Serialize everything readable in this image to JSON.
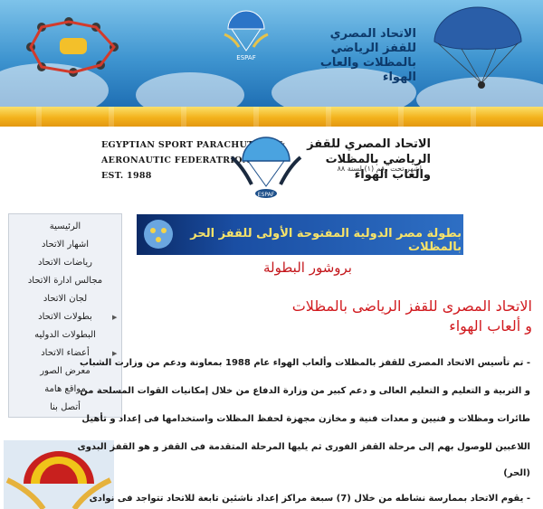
{
  "banner": {
    "title": "الاتحاد المصري للقفز الرياضي بالمظلات والعاب الهواء",
    "logo_text": "ESPAF"
  },
  "header": {
    "en_line1": "EGYPTIAN SPORT PARACHUTING &",
    "en_line2": "AERONAUTIC FEDERATRION",
    "en_line3": "EST. 1988",
    "ar_line1": "الاتحاد المصري للقفز الرياضي بالمظلات",
    "ar_line2": "والعاب الهواء",
    "ar_reg": "اشهر تحت رقم (١) لسنة ٨٨",
    "logo_text": "ESPAF"
  },
  "sidebar": {
    "items": [
      {
        "label": "الرئيسية",
        "submenu": false
      },
      {
        "label": "اشهار الاتحاد",
        "submenu": false
      },
      {
        "label": "رياضات الاتحاد",
        "submenu": false
      },
      {
        "label": "مجالس ادارة الاتحاد",
        "submenu": false
      },
      {
        "label": "لجان الاتحاد",
        "submenu": false
      },
      {
        "label": "بطولات الاتحاد",
        "submenu": true
      },
      {
        "label": "البطولات الدوليه",
        "submenu": false
      },
      {
        "label": "أعضاء الاتحاد",
        "submenu": true
      },
      {
        "label": "معرض الصور",
        "submenu": false
      },
      {
        "label": "مواقع هامة",
        "submenu": false
      },
      {
        "label": "أتصل بنا",
        "submenu": false
      }
    ]
  },
  "main": {
    "champ_banner": "بطولة مصر الدولية المفتوحة الأولى للقفز الحر بالمظلات",
    "brochure_link": "بروشور البطولة",
    "article_title_line1": "الاتحاد المصرى للقفز الرياضى بالمظلات",
    "article_title_line2": "و ألعاب الهواء",
    "paragraph_lines": [
      "- تم تأسيس الاتحاد المصرى للقفز بالمظلات وألعاب الهواء عام 1988 بمعاونة ودعم من وزارت الشباب",
      "و التربية و التعليم و التعليم العالى و دعم كبير من وزارة الدفاع من خلال إمكانيات القوات المسلحة من",
      "طائرات ومظلات و فنيين و معدات فنية و مخازن مجهزة لحفظ المظلات واستخدامها فى إعداد و تأهيل",
      "اللاعبين للوصول بهم إلى مرحلة القفز الفورى ثم يليها المرحلة المتقدمة فى القفز و هو القفز البدوى",
      "(الحر)",
      "- يقوم الاتحاد بممارسة نشاطه من خلال (7) سبعة مراكز إعداد ناشئين تابعة للاتحاد تتواجد فى نوادى"
    ]
  },
  "colors": {
    "banner_blue": "#3f95d0",
    "gold_bar": "#f3b21c",
    "title_red": "#d11a1f",
    "brochure_red": "#c4171c",
    "champ_text_yellow": "#f7e36a",
    "sidebar_bg": "#eef1f6"
  }
}
